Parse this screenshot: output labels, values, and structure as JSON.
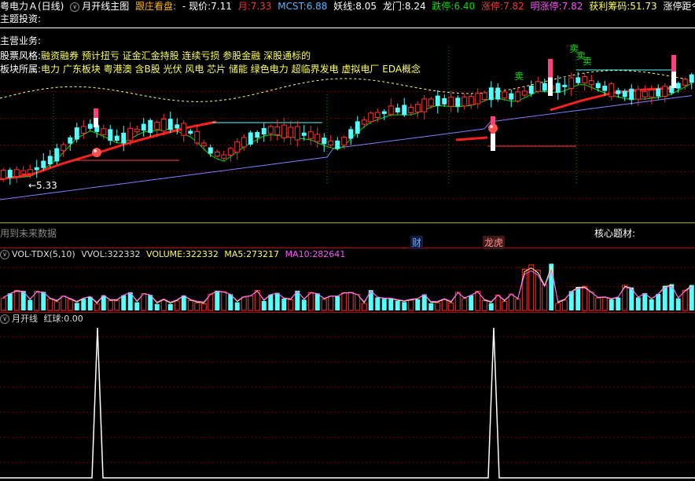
{
  "header": {
    "stock_name": "粤电力Ａ(日线)",
    "indicator_name": "月开线主图",
    "follow_text": "跟庄看盘:",
    "price_label": "现价:",
    "price_value": "7.11",
    "month_label": "月:",
    "month_value": "7.33",
    "mcst_label": "MCST:",
    "mcst_value": "6.88",
    "yao_label": "妖线:",
    "yao_value": "8.05",
    "longmen_label": "龙门:",
    "longmen_value": "8.24",
    "dieting_label": "跌停:",
    "dieting_value": "6.40",
    "zhangting_label": "涨停:",
    "zhangting_value": "7.82",
    "mingzhangting_label": "明涨停:",
    "mingzhangting_value": "7.82",
    "huoli_label": "获利筹码:",
    "huoli_value": "51.73",
    "tail_text": "涨停距今天数:"
  },
  "info": {
    "theme_label": "主题投资:",
    "business_label": "主营业务:",
    "style_label": "股票风格:",
    "style_value": "融资融券 预计扭亏 证金汇金持股 连续亏损 参股金融 深股通标的",
    "sector_label": "板块所属:",
    "sector_value": "电力 广东板块 粤港澳 含B股 光伏 风电 芯片 储能 绿色电力 超临界发电 虚拟电厂 EDA概念"
  },
  "main_chart": {
    "low_marker": "←5.33",
    "sell_labels": [
      "卖",
      "卖",
      "卖",
      "卖"
    ],
    "future_data_text": "用到未来数据",
    "core_theme_label": "核心题材:",
    "cai_badge": "财",
    "longhu_badge": "龙虎"
  },
  "volume_panel": {
    "title": "VOL-TDX(5,10)",
    "vvol_label": "VVOL:",
    "vvol_value": "322332",
    "volume_label": "VOLUME:",
    "volume_value": "322332",
    "ma5_label": "MA5:",
    "ma5_value": "273217",
    "ma10_label": "MA10:",
    "ma10_value": "282641"
  },
  "signal_panel": {
    "title": "月开线",
    "hongqiu_label": "红球:",
    "hongqiu_value": "0.00"
  },
  "colors": {
    "up": "#ff3232",
    "down": "#54ffff",
    "yellow_text": "#ffff54",
    "magenta": "#ff54ff",
    "green": "#00e000",
    "ma_blue": "#8080ff",
    "ma_red": "#ff2020",
    "grid": "#7a0000"
  }
}
